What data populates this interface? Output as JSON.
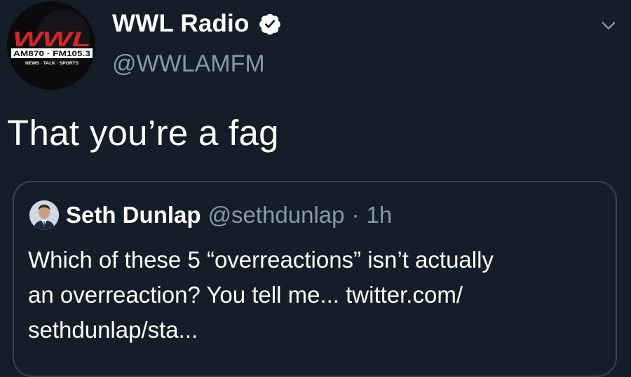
{
  "tweet": {
    "author": {
      "display_name": "WWL Radio",
      "handle": "@WWLAMFM",
      "verified": true,
      "avatar": {
        "logo_text": "WWL",
        "frequencies": "AM870 · FM105.3",
        "tagline": "NEWS · TALK · SPORTS"
      }
    },
    "text": "That you’re a fag",
    "menu_icon": "chevron-down-icon",
    "quoted_tweet": {
      "author_name": "Seth Dunlap",
      "author_handle": "@sethdunlap",
      "separator": "·",
      "time": "1h",
      "text_lines": [
        "Which of these 5 “overreactions” isn’t actually",
        "an overreaction?  You tell me... twitter.com/",
        "sethdunlap/sta..."
      ]
    }
  },
  "colors": {
    "background": "#151d28",
    "secondary_text": "#8899a6",
    "border": "#38444d",
    "logo_red": "#d2262b"
  }
}
